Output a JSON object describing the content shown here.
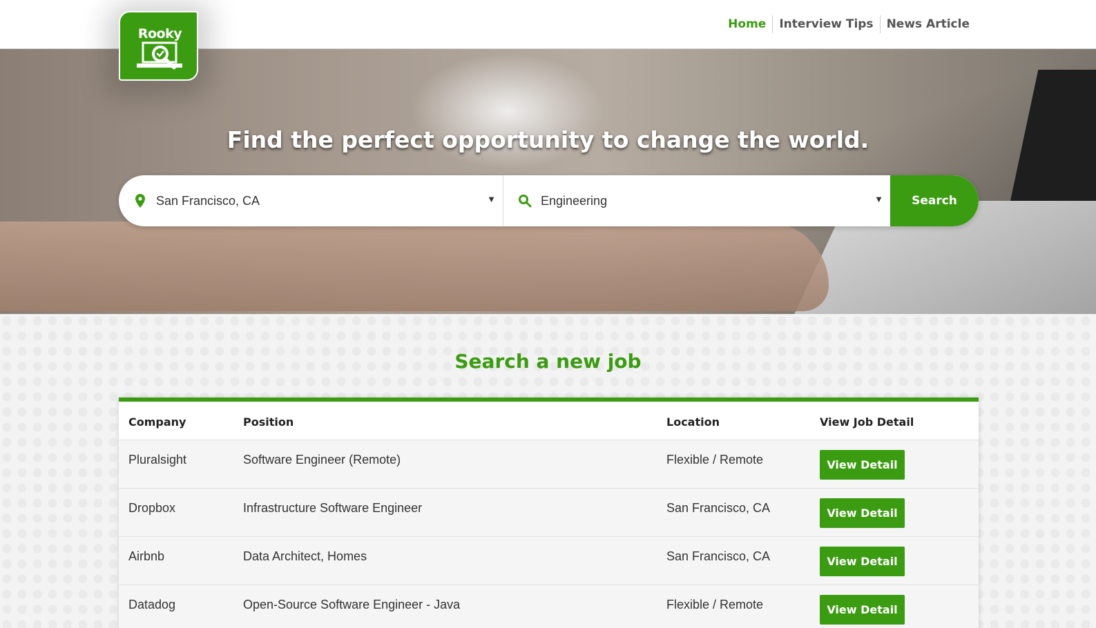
{
  "header": {
    "logo_text": "Rooky",
    "nav": [
      {
        "label": "Home",
        "active": true
      },
      {
        "label": "Interview Tips",
        "active": false
      },
      {
        "label": "News Article",
        "active": false
      }
    ]
  },
  "hero": {
    "title": "Find the perfect opportunity to change the world.",
    "location": {
      "value": "San Francisco, CA",
      "icon": "map-pin-icon"
    },
    "category": {
      "value": "Engineering",
      "icon": "search-icon"
    },
    "search_label": "Search"
  },
  "main": {
    "section_title": "Search a new job",
    "table": {
      "headers": [
        "Company",
        "Position",
        "Location",
        "View Job Detail"
      ],
      "rows": [
        {
          "company": "Pluralsight",
          "position": "Software Engineer (Remote)",
          "location": "Flexible / Remote",
          "action": "View Detail"
        },
        {
          "company": "Dropbox",
          "position": "Infrastructure Software Engineer",
          "location": "San Francisco, CA",
          "action": "View Detail"
        },
        {
          "company": "Airbnb",
          "position": "Data Architect, Homes",
          "location": "San Francisco, CA",
          "action": "View Detail"
        },
        {
          "company": "Datadog",
          "position": "Open-Source Software Engineer - Java",
          "location": "Flexible / Remote",
          "action": "View Detail"
        }
      ]
    }
  },
  "colors": {
    "brand": "#3b9c12"
  }
}
